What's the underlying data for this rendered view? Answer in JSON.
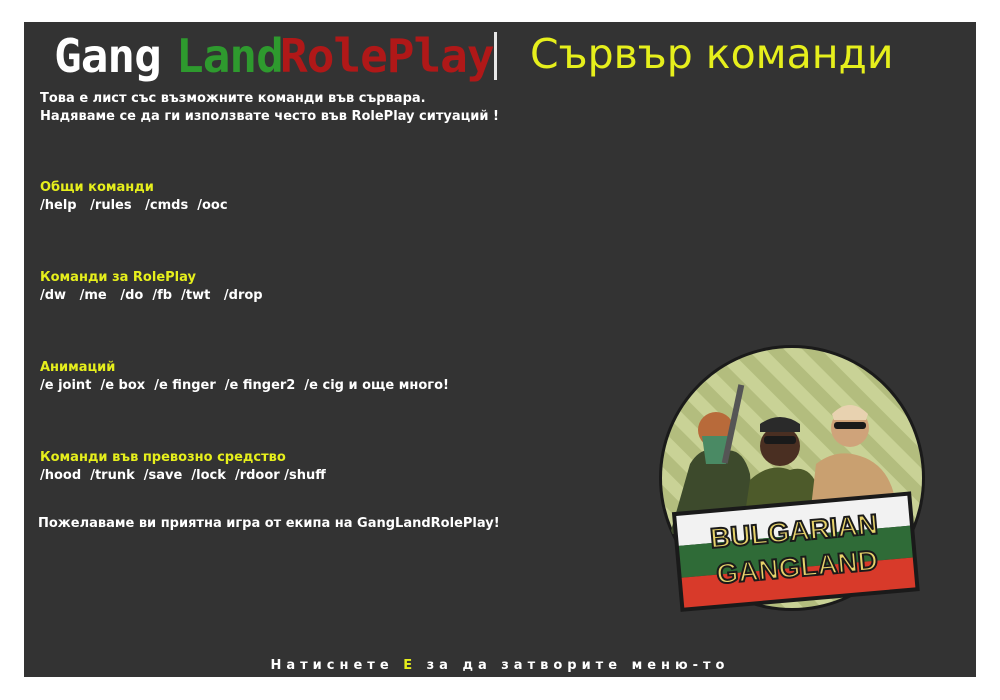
{
  "header": {
    "brand_word1": "Gang",
    "brand_word2": "Land",
    "brand_word3": "RolePlay",
    "title": "Сървър команди"
  },
  "intro": {
    "line1": "Това е лист със възможните команди във сървара.",
    "line2": "Надяваме се да ги използвате често във RolePlay ситуаций !"
  },
  "sections": [
    {
      "title": "Общи команди",
      "commands": "/help   /rules   /cmds  /ooc"
    },
    {
      "title": "Команди за RolePlay",
      "commands": "/dw   /me   /do  /fb  /twt   /drop"
    },
    {
      "title": "Анимаций",
      "commands": "/e joint  /e box  /e finger  /e finger2  /e cig и още много!"
    },
    {
      "title": "Команди във превозно средство",
      "commands": "/hood  /trunk  /save  /lock  /rdoor /shuff"
    }
  ],
  "farewell": "Пожелаваме ви приятна игра от екипа на GangLandRolePlay!",
  "footer": {
    "before": "Натиснете ",
    "key": "E",
    "after": " за да затворите меню-то"
  },
  "logo": {
    "line1": "BULGARIAN",
    "line2": "GANGLAND"
  },
  "colors": {
    "panel_bg": "#333333",
    "accent_yellow": "#e6ef1c",
    "brand_green": "#2e9a2e",
    "brand_red": "#b01818",
    "flag_white": "#f2f2f2",
    "flag_green": "#2f6b37",
    "flag_red": "#d83a2a"
  }
}
